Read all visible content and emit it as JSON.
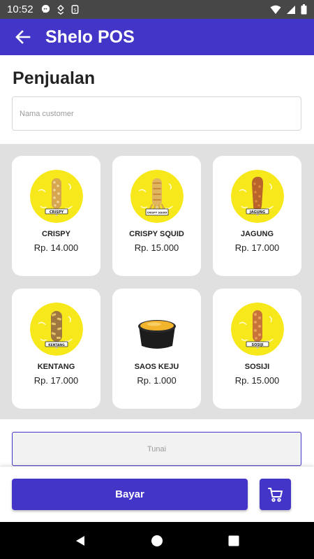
{
  "status_bar": {
    "time": "10:52"
  },
  "app_bar": {
    "title": "Shelo POS"
  },
  "page": {
    "title": "Penjualan",
    "customer_placeholder": "Nama customer",
    "cash_placeholder": "Tunai",
    "pay_label": "Bayar"
  },
  "products": [
    {
      "name": "CRISPY",
      "price": "Rp. 14.000",
      "stick_label": "CRISPY"
    },
    {
      "name": "CRISPY SQUID",
      "price": "Rp. 15.000",
      "stick_label": "CRISPY SQUID"
    },
    {
      "name": "JAGUNG",
      "price": "Rp. 17.000",
      "stick_label": "JAGUNG"
    },
    {
      "name": "KENTANG",
      "price": "Rp. 17.000",
      "stick_label": "KENTANG"
    },
    {
      "name": "SAOS KEJU",
      "price": "Rp. 1.000",
      "stick_label": ""
    },
    {
      "name": "SOSIJI",
      "price": "Rp. 15.000",
      "stick_label": "SOSIJI"
    }
  ],
  "colors": {
    "primary": "#4335c8",
    "status_bar": "#474747",
    "grid_background": "#e0e0e0",
    "product_circle": "#f7e81c"
  },
  "icons": {
    "back": "arrow-left-icon",
    "cart": "shopping-cart-icon",
    "nav_back": "triangle-back-icon",
    "nav_home": "circle-home-icon",
    "nav_recent": "square-recents-icon"
  }
}
